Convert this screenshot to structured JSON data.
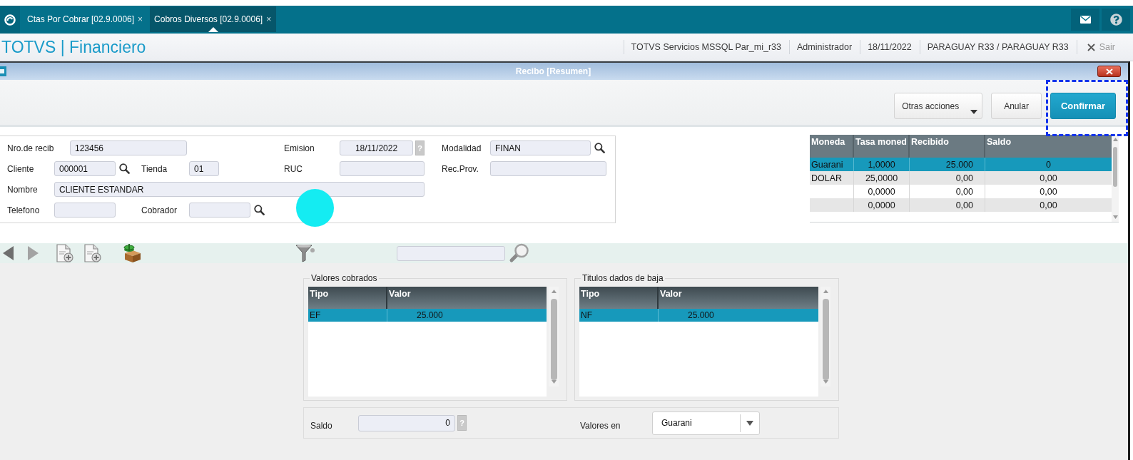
{
  "top_bar": {
    "tabs": [
      {
        "label": "Ctas Por Cobrar [02.9.0006]",
        "close": "×",
        "selected": false
      },
      {
        "label": "Cobros Diversos [02.9.0006]",
        "close": "×",
        "selected": true
      }
    ]
  },
  "header": {
    "title": "TOTVS | Financiero",
    "info": [
      "TOTVS Servicios MSSQL Par_mi_r33",
      "Administrador",
      "18/11/2022",
      "PARAGUAY R33 / PARAGUAY R33"
    ],
    "exit": "Sair"
  },
  "dialog": {
    "title": "Recibo [Resumen]",
    "actions": [
      {
        "label": "Otras acciones",
        "kind": "menu",
        "highlighted": false
      },
      {
        "label": "Anular",
        "kind": "default",
        "highlighted": false
      },
      {
        "label": "Confirmar",
        "kind": "primary",
        "highlighted": true
      }
    ]
  },
  "form": {
    "click_marker": true,
    "fields": [
      {
        "label": "Nro.de recib",
        "value": "123456",
        "lookup": false
      },
      {
        "label": "Emision",
        "value": "18/11/2022",
        "help": "?",
        "lookup": false
      },
      {
        "label": "Modalidad",
        "value": "FINAN",
        "lookup": true
      },
      {
        "label": "Cliente",
        "value": "000001",
        "lookup": true
      },
      {
        "label": "Tienda",
        "value": "01",
        "lookup": false
      },
      {
        "label": "RUC",
        "lookup": false
      },
      {
        "label": "Rec.Prov.",
        "lookup": false
      },
      {
        "label": "Nombre",
        "value": "CLIENTE ESTANDAR",
        "lookup": false
      },
      {
        "label": "Telefono",
        "lookup": false
      },
      {
        "label": "Cobrador",
        "lookup": true
      }
    ]
  },
  "currency_table": {
    "columns": [
      "Moneda",
      "Tasa moned",
      "Recibido",
      "Saldo"
    ],
    "rows": [
      {
        "moneda": "Guarani",
        "tasa_moneda": "1,0000",
        "recibido": "25.000",
        "saldo": "0",
        "selected": true
      },
      {
        "moneda": "DOLAR",
        "tasa_moneda": "25,0000",
        "recibido": "0,00",
        "saldo": "0,00",
        "selected": false
      },
      {
        "tasa_moneda": "0,0000",
        "recibido": "0,00",
        "saldo": "0,00",
        "selected": false
      },
      {
        "tasa_moneda": "0,0000",
        "recibido": "0,00",
        "saldo": "0,00",
        "selected": false
      }
    ]
  },
  "grids": [
    {
      "title": "Valores cobrados",
      "columns": [
        "Tipo",
        "Valor"
      ],
      "rows": [
        {
          "tipo": "EF",
          "valor": "25.000",
          "selected": true
        }
      ]
    },
    {
      "title": "Titulos dados de baja",
      "columns": [
        "Tipo",
        "Valor"
      ],
      "rows": [
        {
          "tipo": "NF",
          "valor": "25.000",
          "selected": true
        }
      ]
    }
  ],
  "summary": {
    "saldo": {
      "label": "Saldo",
      "value": "0",
      "help": "?"
    },
    "valores_en": {
      "label": "Valores en",
      "value": "Guarani"
    }
  }
}
